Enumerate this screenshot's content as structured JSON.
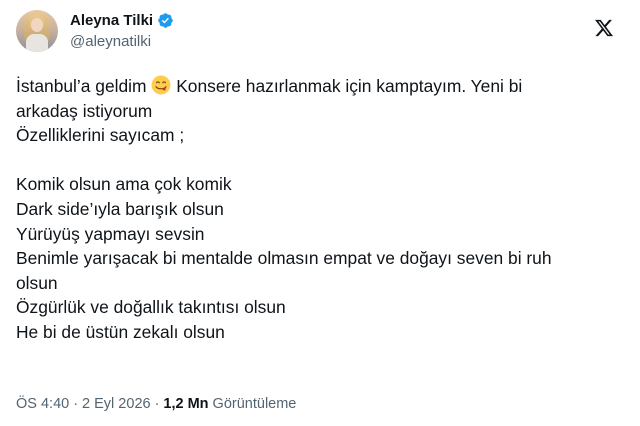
{
  "author": {
    "display_name": "Aleyna Tilki",
    "handle": "@aleynatilki",
    "verified_color": "#1d9bf0"
  },
  "tweet": {
    "line1_before_emoji": "İstanbul’a geldim",
    "emoji": "face-savoring-food",
    "line1_after_emoji": " Konsere hazırlanmak için kamptayım. Yeni bi",
    "line2": "arkadaş istiyorum",
    "line3": "Özelliklerini sayıcam ;",
    "list": [
      "Komik olsun ama çok komik",
      "Dark side’ıyla barışık olsun",
      "Yürüyüş yapmayı sevsin",
      "Benimle yarışacak bi mentalde olmasın empat ve doğayı seven bi ruh",
      "olsun",
      "Özgürlük ve doğallık takıntısı olsun",
      "He bi de üstün zekalı olsun"
    ]
  },
  "meta": {
    "time": "ÖS 4:40",
    "separator": "·",
    "date": "2 Eyl 2026",
    "views_count": "1,2 Mn",
    "views_label": "Görüntüleme"
  }
}
